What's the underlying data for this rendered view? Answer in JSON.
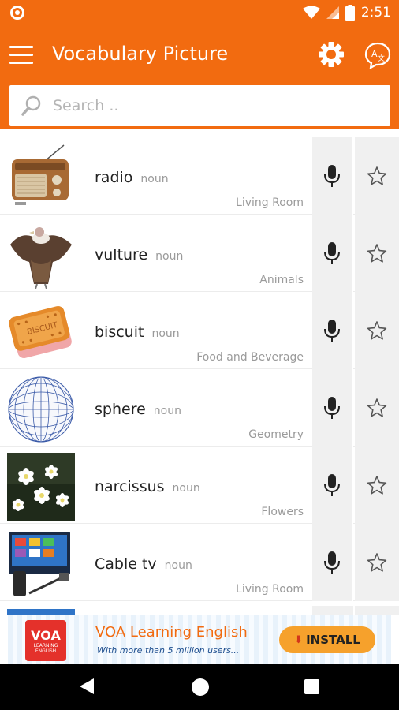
{
  "status_bar": {
    "time": "2:51"
  },
  "app_bar": {
    "title": "Vocabulary Picture"
  },
  "search": {
    "placeholder": "Search .."
  },
  "words": [
    {
      "word": "radio",
      "pos": "noun",
      "category": "Living Room",
      "thumb": "radio"
    },
    {
      "word": "vulture",
      "pos": "noun",
      "category": "Animals",
      "thumb": "vulture"
    },
    {
      "word": "biscuit",
      "pos": "noun",
      "category": "Food and Beverage",
      "thumb": "biscuit"
    },
    {
      "word": "sphere",
      "pos": "noun",
      "category": "Geometry",
      "thumb": "sphere"
    },
    {
      "word": "narcissus",
      "pos": "noun",
      "category": "Flowers",
      "thumb": "narcissus"
    },
    {
      "word": "Cable tv",
      "pos": "noun",
      "category": "Living Room",
      "thumb": "cable-tv"
    }
  ],
  "ad": {
    "logo_text": "VOA",
    "logo_caption": "LEARNING ENGLISH",
    "title": "VOA Learning English",
    "subtitle": "With more than 5 million users...",
    "install_label": "INSTALL"
  },
  "colors": {
    "primary": "#f26b10",
    "install": "#f6a12c"
  }
}
